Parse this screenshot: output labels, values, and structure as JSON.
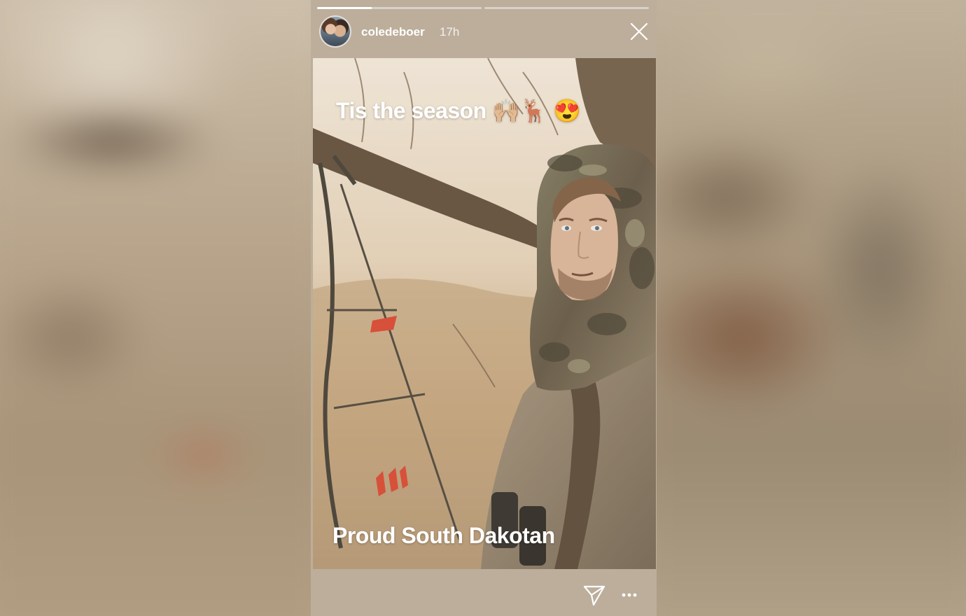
{
  "story": {
    "progress": [
      0.33,
      0
    ],
    "user": {
      "username": "coledeboer",
      "time": "17h"
    },
    "captions": {
      "top": "Tis the season 🙌🏼🦌 😍",
      "bottom": "Proud South Dakotan"
    }
  },
  "icons": {
    "close": "close-icon",
    "send": "send-icon",
    "more": "more-icon"
  },
  "colors": {
    "text": "#ffffff",
    "background": "#bcae9b"
  }
}
